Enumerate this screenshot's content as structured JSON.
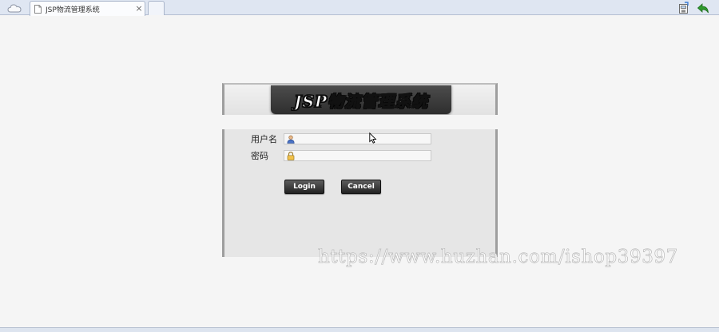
{
  "browser": {
    "tab_title": "JSP物流管理系统",
    "tab_close": "×"
  },
  "header": {
    "system_title": "JSP物流管理系统"
  },
  "form": {
    "username_label": "用户名",
    "username_value": "",
    "password_label": "密码",
    "password_value": ""
  },
  "buttons": {
    "login_label": "Login",
    "cancel_label": "Cancel"
  },
  "watermark": {
    "text": "https://www.huzhan.com/ishop39397"
  },
  "icons": {
    "home": "cloud-home-icon",
    "page": "page-icon",
    "save": "save-page-icon",
    "back": "back-arrow-icon",
    "user": "user-icon",
    "lock": "lock-icon",
    "cursor": "mouse-cursor-icon"
  },
  "colors": {
    "panel_bg": "#e6e6e6",
    "title_plate": "#3a3a3a",
    "button_bg": "#2e2e2e",
    "back_arrow": "#2e9a2e"
  }
}
